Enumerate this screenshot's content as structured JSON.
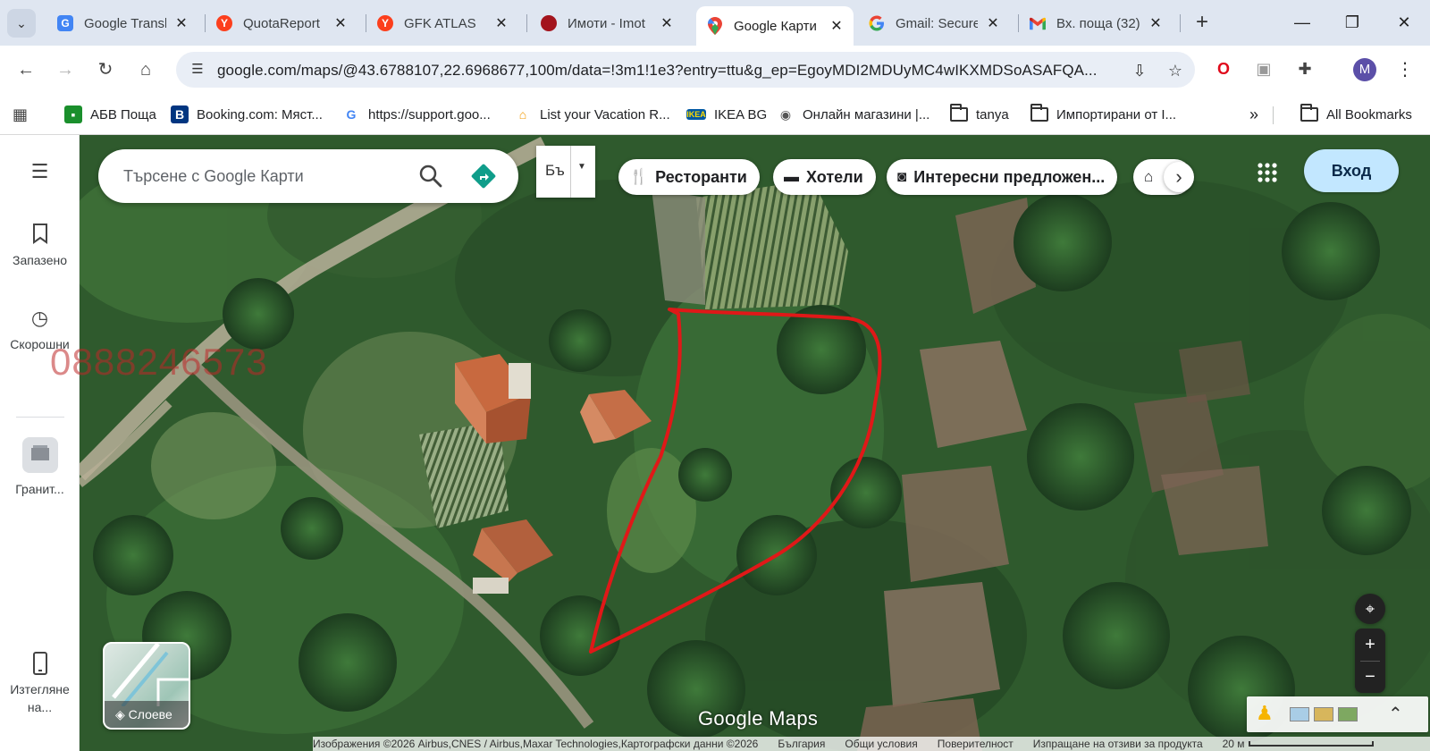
{
  "tabs": [
    {
      "title": "Google Transl",
      "active": false,
      "favicon": "google-translate-icon",
      "color": "#4285f4"
    },
    {
      "title": "QuotaReport",
      "active": false,
      "favicon": "yandex-icon",
      "color": "#fc3f1d"
    },
    {
      "title": "GFK ATLAS",
      "active": false,
      "favicon": "yandex-icon",
      "color": "#fc3f1d"
    },
    {
      "title": "Имоти - Imot",
      "active": false,
      "favicon": "imot-icon",
      "color": "#a3141d"
    },
    {
      "title": "Google Карти",
      "active": true,
      "favicon": "google-maps-icon",
      "color": "#34a853"
    },
    {
      "title": "Gmail: Secure",
      "active": false,
      "favicon": "google-icon",
      "color": "#4285f4"
    },
    {
      "title": "Вх. поща (32)",
      "active": false,
      "favicon": "gmail-icon",
      "color": "#ea4335"
    }
  ],
  "omnibox": {
    "url": "google.com/maps/@43.6788107,22.6968677,100m/data=!3m1!1e3?entry=ttu&g_ep=EgoyMDI2MDUyMC4wIKXMDSoASAFQA..."
  },
  "profile_initial": "M",
  "bookmarks": [
    {
      "label": "АБВ Поща",
      "icon": "abv-icon"
    },
    {
      "label": "Booking.com: Мяст...",
      "icon": "booking-icon"
    },
    {
      "label": "https://support.goo...",
      "icon": "google-icon"
    },
    {
      "label": "List your Vacation R...",
      "icon": "vacation-icon"
    },
    {
      "label": "IKEA BG",
      "icon": "ikea-icon"
    },
    {
      "label": "Онлайн магазини |...",
      "icon": "shop-icon"
    },
    {
      "label": "tanya",
      "icon": "folder-icon"
    },
    {
      "label": "Импортирани от I...",
      "icon": "folder-icon"
    }
  ],
  "bookmarks_overflow": "»",
  "all_bookmarks": "All Bookmarks",
  "rail": {
    "saved": "Запазено",
    "recent": "Скорошни",
    "place": "Гранит...",
    "download": "Изтегляне на..."
  },
  "search": {
    "placeholder": "Търсене с Google Карти"
  },
  "input_tools_label": "Бъ",
  "chips": [
    {
      "label": "Ресторанти",
      "icon": "fork-knife-icon"
    },
    {
      "label": "Хотели",
      "icon": "bed-icon"
    },
    {
      "label": "Интересни предложен...",
      "icon": "camera-icon"
    }
  ],
  "login_label": "Вход",
  "layers_label": "Слоеве",
  "watermark": "0888246573",
  "logo_text": "Google Maps",
  "attribution": {
    "imagery": "Изображения ©2026 Airbus,CNES / Airbus,Maxar Technologies,Картографски данни ©2026",
    "country": "България",
    "terms": "Общи условия",
    "privacy": "Поверителност",
    "feedback": "Изпращане на отзиви за продукта",
    "scale": "20 м"
  },
  "colors": {
    "accent_blue": "#1a73e8",
    "login_bg": "#c2e7ff",
    "boundary_red": "#e01818",
    "teal_direction": "#0f9d8a"
  }
}
